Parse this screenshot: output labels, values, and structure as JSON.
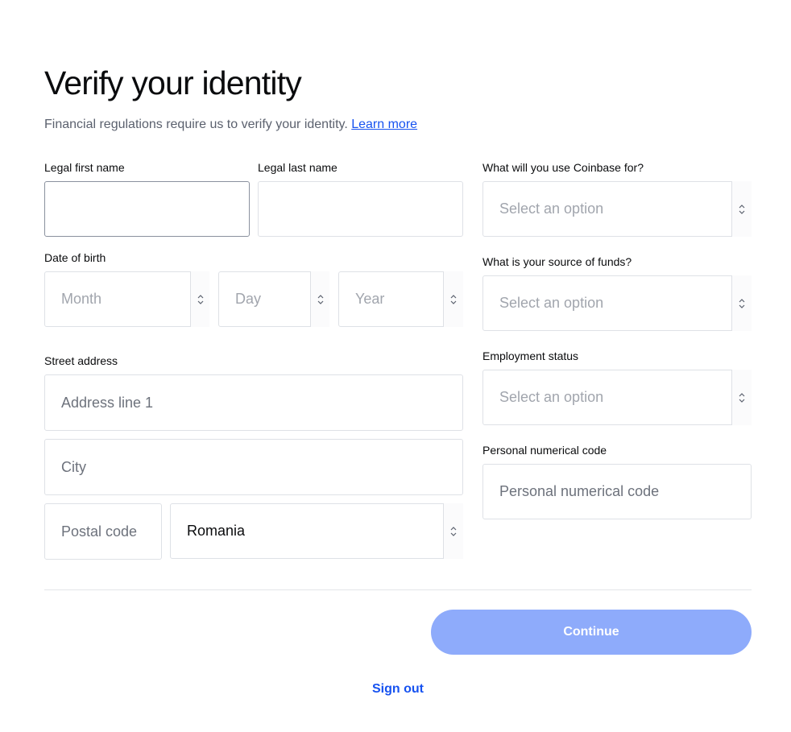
{
  "header": {
    "title": "Verify your identity",
    "subtitle": "Financial regulations require us to verify your identity.",
    "learn_more": "Learn more"
  },
  "form": {
    "first_name": {
      "label": "Legal first name",
      "value": "",
      "placeholder": "",
      "state": "focused"
    },
    "last_name": {
      "label": "Legal last name",
      "value": "",
      "placeholder": ""
    },
    "dob": {
      "label": "Date of birth",
      "month": "Month",
      "day": "Day",
      "year": "Year"
    },
    "address": {
      "label": "Street address",
      "line1_placeholder": "Address line 1",
      "city_placeholder": "City",
      "postal_placeholder": "Postal code",
      "country": "Romania"
    },
    "use": {
      "label": "What will you use Coinbase for?",
      "value": "Select an option"
    },
    "funds": {
      "label": "What is your source of funds?",
      "value": "Select an option"
    },
    "employment": {
      "label": "Employment status",
      "value": "Select an option"
    },
    "pnc": {
      "label": "Personal numerical code",
      "placeholder": "Personal numerical code"
    }
  },
  "footer": {
    "continue": "Continue",
    "sign_out": "Sign out"
  },
  "colors": {
    "accent": "#1652f0",
    "button_disabled": "#8eabfb"
  }
}
